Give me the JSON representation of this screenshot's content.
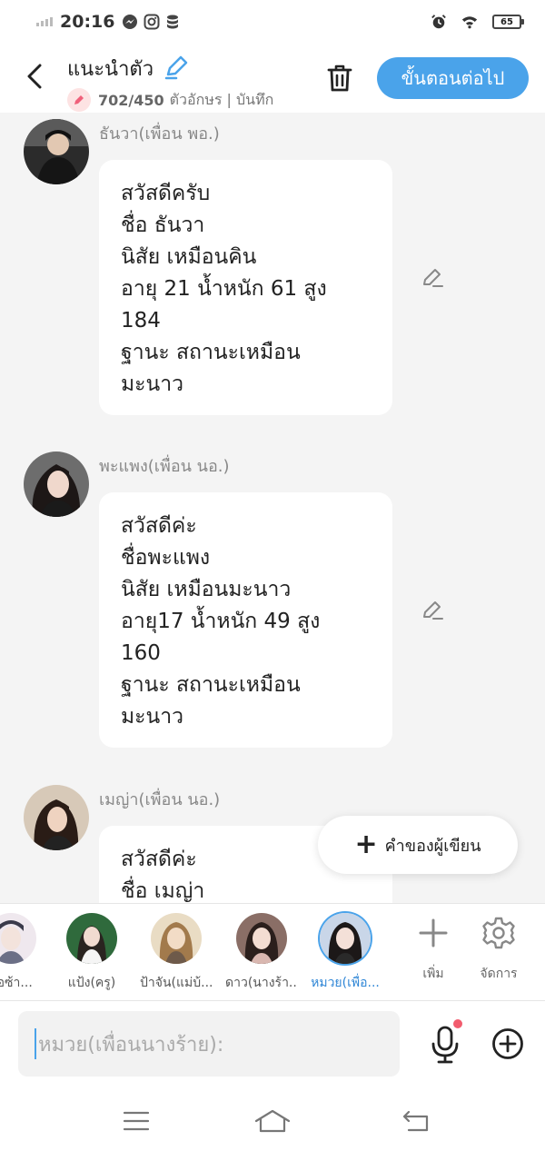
{
  "status": {
    "time": "20:16",
    "battery": "65",
    "icons": [
      "signal-icon",
      "messenger-icon",
      "instagram-icon",
      "data-icon",
      "alarm-icon",
      "wifi-icon",
      "battery-icon"
    ]
  },
  "header": {
    "title": "แนะนำตัว",
    "counter": "702/450",
    "sub_label": "ตัวอักษร | บันทึก",
    "next_label": "ขั้นตอนต่อไป",
    "accent": "#4aa3ea"
  },
  "messages": [
    {
      "sender": "ธันวา(เพื่อน พอ.)",
      "lines": [
        "สวัสดีครับ",
        "ชื่อ ธันวา",
        "นิสัย เหมือนคิน",
        "อายุ 21 น้ำหนัก 61 สูง",
        "184",
        "ฐานะ สถานะเหมือน",
        "มะนาว"
      ]
    },
    {
      "sender": "พะแพง(เพื่อน นอ.)",
      "lines": [
        "สวัสดีค่ะ",
        "ชื่อพะแพง",
        "นิสัย เหมือนมะนาว",
        "อายุ17  น้ำหนัก 49 สูง",
        "160",
        "ฐานะ สถานะเหมือน",
        "มะนาว"
      ]
    },
    {
      "sender": "เมญ่า(เพื่อน นอ.)",
      "lines": [
        "สวัสดีค่ะ",
        "ชื่อ เมญ่า"
      ]
    }
  ],
  "author_label": "คำของผู้เขียน",
  "characters": [
    {
      "name": "อ้อซ้า..."
    },
    {
      "name": "แป้ง(ครู)"
    },
    {
      "name": "ป้าจัน(แม่บ้..."
    },
    {
      "name": "ดาว(นางร้า..."
    },
    {
      "name": "หมวย(เพื่อ..."
    }
  ],
  "tools": {
    "add_label": "เพิ่ม",
    "manage_label": "จัดการ"
  },
  "input": {
    "placeholder": "หมวย(เพื่อนนางร้าย):"
  }
}
